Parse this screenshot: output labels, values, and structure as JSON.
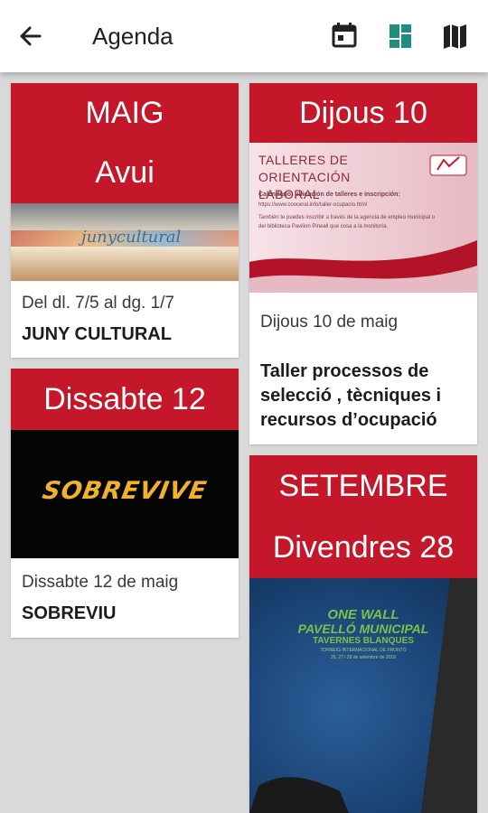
{
  "appbar": {
    "title": "Agenda",
    "back_icon": "arrow-back-icon",
    "actions": [
      {
        "icon": "calendar-icon"
      },
      {
        "icon": "grid-view-icon",
        "active": true
      },
      {
        "icon": "map-icon"
      }
    ],
    "accent": "#1e8c7e"
  },
  "colors": {
    "header_red": "#c4172a",
    "background": "#d9d9d9"
  },
  "cards": [
    {
      "header": [
        "MAIG",
        "Avui"
      ],
      "image_text": "junycultural",
      "date": "Del dl. 7/5 al dg. 1/7",
      "title": "JUNY CULTURAL"
    },
    {
      "header": [
        "Dijous 10"
      ],
      "image": {
        "heading": "TALLERES DE ORIENTACIÓN LABORAL",
        "sub": "Calendario, ubicación de talleres e inscripción:",
        "url": "https://www.cooceral.info/taller-ocupacio.html",
        "body": "También te puedes inscribir a través de la agencia de empleo municipal o del biblioteca Pavilion Pineall que cosa a la monitoría."
      },
      "date": "Dijous 10 de maig",
      "title": "Taller processos de selecció , tècniques i recursos d’ocupació"
    },
    {
      "header": [
        "Dissabte 12"
      ],
      "image_text": "SOBREVIVE",
      "date": "Dissabte 12 de maig",
      "title": "SOBREVIU"
    },
    {
      "header": [
        "SETEMBRE",
        "Divendres 28"
      ],
      "image": {
        "line1": "ONE WALL",
        "line2": "PAVELLÓ MUNICIPAL",
        "line3": "TAVERNES BLANQUES",
        "line4": "TORNEIG INTERNACIONAL DE FRONTÓ",
        "line5": "26, 27 i 28 de setembre de 2018"
      }
    }
  ]
}
